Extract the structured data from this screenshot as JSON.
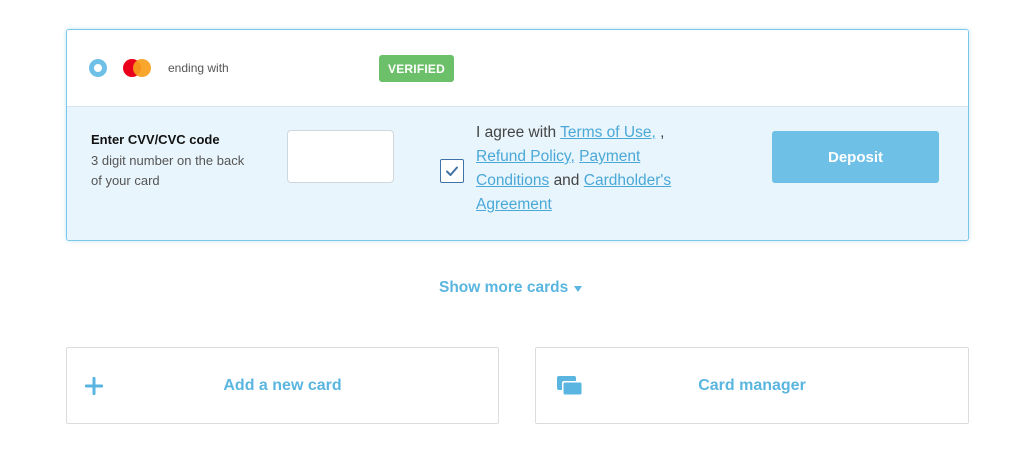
{
  "selected_card": {
    "ending_label": "ending with",
    "verified_badge": "VERIFIED",
    "brand_icon": "mastercard-icon"
  },
  "cvv": {
    "title": "Enter CVV/CVC code",
    "hint": "3 digit number on the back of your card",
    "value": ""
  },
  "agreement": {
    "checked": true,
    "prefix": "I agree with",
    "terms_link": "Terms of Use,",
    "sep1": " ,",
    "refund_link": "Refund Policy,",
    "payment_link": "Payment Conditions",
    "and": "and",
    "cardholder_link": "Cardholder's Agreement"
  },
  "deposit_label": "Deposit",
  "show_more_label": "Show more cards",
  "add_card_label": "Add a new card",
  "card_manager_label": "Card manager",
  "colors": {
    "accent": "#6ec0e6",
    "link": "#4aa8d8",
    "verified": "#6cc06a",
    "panel_bg": "#e8f5fc"
  }
}
